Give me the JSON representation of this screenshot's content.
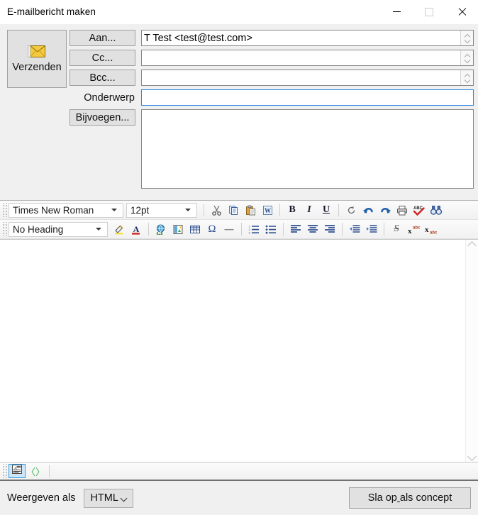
{
  "window": {
    "title": "E-mailbericht maken",
    "controls": {
      "minimize": "minimize-icon",
      "maximize": "maximize-icon",
      "close": "close-icon"
    }
  },
  "compose": {
    "send_button": {
      "label": "Verzenden",
      "icon": "envelope-icon"
    },
    "fields": [
      {
        "name": "to",
        "button_label": "Aan...",
        "is_button": true,
        "value": "T Test <test@test.com>",
        "placeholder": "",
        "focused": false,
        "has_spinner": true
      },
      {
        "name": "cc",
        "button_label": "Cc...",
        "is_button": true,
        "value": "",
        "placeholder": "",
        "focused": false,
        "has_spinner": true
      },
      {
        "name": "bcc",
        "button_label": "Bcc...",
        "is_button": true,
        "value": "",
        "placeholder": "",
        "focused": false,
        "has_spinner": true
      },
      {
        "name": "subject",
        "button_label": "Onderwerp",
        "is_button": false,
        "value": "",
        "placeholder": "",
        "focused": true,
        "has_spinner": false
      }
    ],
    "attach_button_label": "Bijvoegen...",
    "attachments": []
  },
  "toolbar": {
    "row1": {
      "font_family": "Times New Roman",
      "font_size": "12pt",
      "buttons": [
        {
          "name": "cut-icon",
          "title": "Cut"
        },
        {
          "name": "copy-icon",
          "title": "Copy"
        },
        {
          "name": "paste-icon",
          "title": "Paste"
        },
        {
          "name": "paste-from-word-icon",
          "title": "Paste from Word"
        },
        {
          "name": "bold-icon",
          "title": "Bold",
          "glyph": "B"
        },
        {
          "name": "italic-icon",
          "title": "Italic",
          "glyph": "I"
        },
        {
          "name": "underline-icon",
          "title": "Underline",
          "glyph": "U"
        },
        {
          "name": "remove-format-icon",
          "title": "Remove formatting"
        },
        {
          "name": "undo-icon",
          "title": "Undo"
        },
        {
          "name": "redo-icon",
          "title": "Redo"
        },
        {
          "name": "print-icon",
          "title": "Print"
        },
        {
          "name": "spellcheck-icon",
          "title": "Spell check"
        },
        {
          "name": "find-icon",
          "title": "Find"
        }
      ]
    },
    "row2": {
      "heading": "No Heading",
      "buttons": [
        {
          "name": "highlight-color-icon",
          "title": "Highlight color"
        },
        {
          "name": "font-color-icon",
          "title": "Font color"
        },
        {
          "name": "insert-link-icon",
          "title": "Insert link"
        },
        {
          "name": "insert-image-icon",
          "title": "Insert image"
        },
        {
          "name": "insert-table-icon",
          "title": "Insert table"
        },
        {
          "name": "special-character-icon",
          "title": "Special character",
          "glyph": "Ω"
        },
        {
          "name": "horizontal-rule-icon",
          "title": "Horizontal rule"
        },
        {
          "name": "numbered-list-icon",
          "title": "Numbered list"
        },
        {
          "name": "bulleted-list-icon",
          "title": "Bulleted list"
        },
        {
          "name": "align-left-icon",
          "title": "Align left"
        },
        {
          "name": "align-center-icon",
          "title": "Align center"
        },
        {
          "name": "align-right-icon",
          "title": "Align right"
        },
        {
          "name": "decrease-indent-icon",
          "title": "Decrease indent"
        },
        {
          "name": "increase-indent-icon",
          "title": "Increase indent"
        },
        {
          "name": "strikethrough-icon",
          "title": "Strikethrough",
          "glyph": "S"
        },
        {
          "name": "superscript-icon",
          "title": "Superscript"
        },
        {
          "name": "subscript-icon",
          "title": "Subscript"
        }
      ]
    }
  },
  "editor": {
    "content": "",
    "scrollbar": {
      "up": "chevron-up-icon",
      "down": "chevron-down-icon"
    }
  },
  "view_modes": [
    {
      "name": "wysiwyg-view-toggle",
      "icon": "wysiwyg-icon",
      "active": true
    },
    {
      "name": "source-view-toggle",
      "icon": "source-code-icon",
      "glyph": "〈〉",
      "active": false
    }
  ],
  "footer": {
    "display_as_label": "Weergeven als",
    "format_value": "HTML",
    "save_draft_label": "Sla op als concept",
    "save_draft_accel_index": 6
  },
  "colors": {
    "window_bg": "#f0f0f0",
    "field_border": "#888888",
    "focus_border": "#2e86de",
    "button_face": "#e1e1e1",
    "button_border": "#a0a0a0",
    "envelope_gold": "#f2c230",
    "accent_blue": "#3399dd",
    "toolbar_icon_blue": "#2f4f8f",
    "spell_red": "#cc2222",
    "source_green": "#3ab54a"
  }
}
